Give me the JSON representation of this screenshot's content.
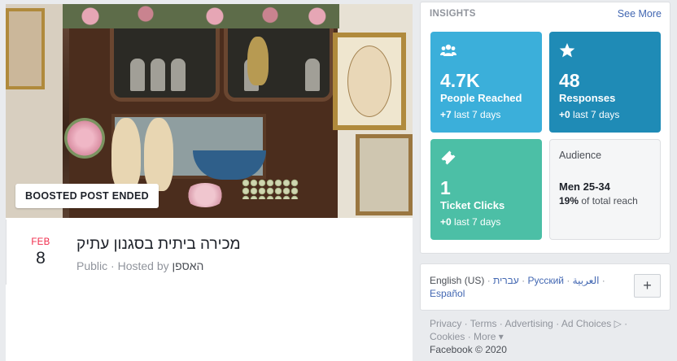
{
  "event": {
    "badge": "BOOSTED POST ENDED",
    "month": "FEB",
    "day": "8",
    "title": "מכירה ביתית בסגנון עתיק",
    "privacy": "Public",
    "hosted_by_label": "Hosted by",
    "host": "האספן"
  },
  "insights": {
    "heading": "INSIGHTS",
    "see_more": "See More",
    "tiles": [
      {
        "icon": "people-icon",
        "value": "4.7K",
        "label": "People Reached",
        "delta": "+7",
        "period": "last 7 days",
        "color": "#3bafda"
      },
      {
        "icon": "star-icon",
        "value": "48",
        "label": "Responses",
        "delta": "+0",
        "period": "last 7 days",
        "color": "#1f8bb6"
      },
      {
        "icon": "ticket-icon",
        "value": "1",
        "label": "Ticket Clicks",
        "delta": "+0",
        "period": "last 7 days",
        "color": "#4cbfa6"
      }
    ],
    "audience": {
      "title": "Audience",
      "main": "Men 25-34",
      "percent": "19%",
      "percent_suffix": "of total reach"
    }
  },
  "languages": {
    "current": "English (US)",
    "options": [
      "עברית",
      "Русский",
      "العربية",
      "Español"
    ],
    "plus": "+"
  },
  "footer": {
    "links": [
      "Privacy",
      "Terms",
      "Advertising",
      "Ad Choices",
      "Cookies",
      "More"
    ],
    "copyright": "Facebook © 2020"
  }
}
